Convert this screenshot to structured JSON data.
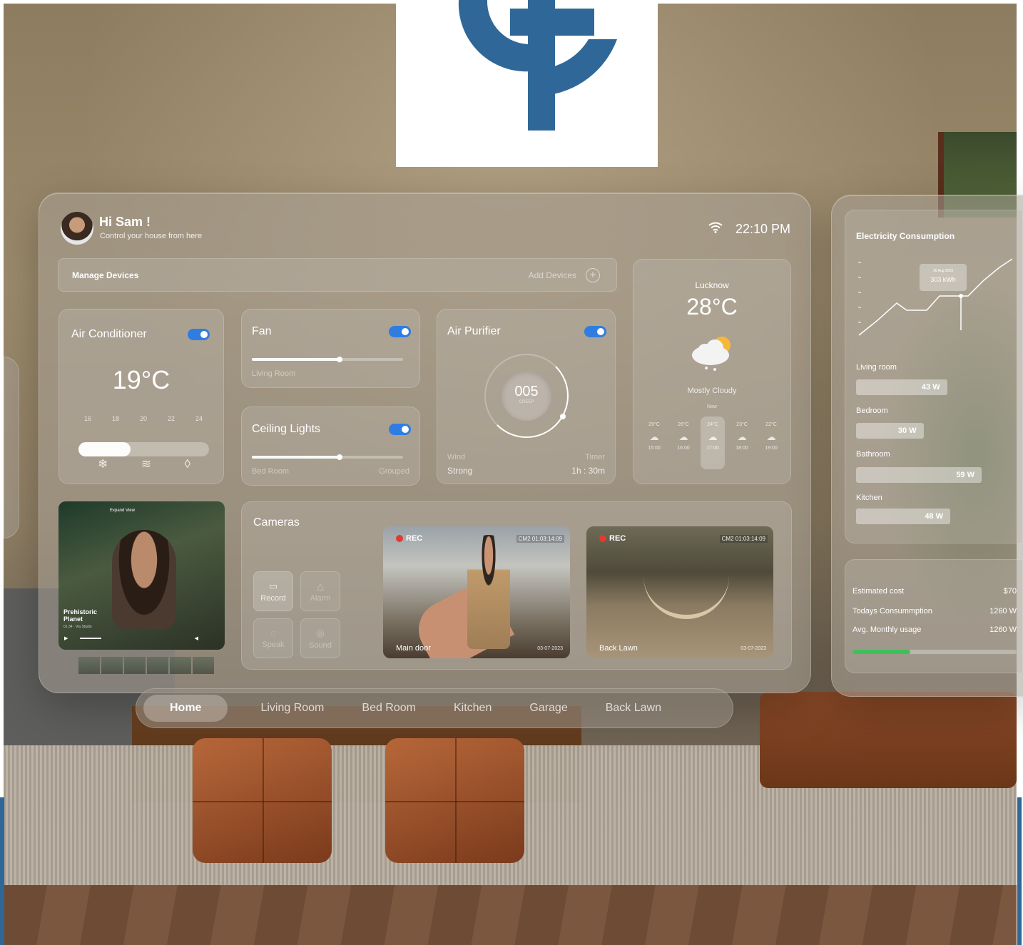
{
  "header": {
    "greeting": "Hi Sam !",
    "subtitle": "Control your house from here",
    "time": "22:10 PM"
  },
  "manage": {
    "label": "Manage Devices",
    "add_label": "Add Devices"
  },
  "ac": {
    "title": "Air Conditioner",
    "temp": "19°C",
    "scale": [
      "16",
      "18",
      "20",
      "22",
      "24"
    ],
    "level": 0.4,
    "modes": [
      "snowflake-icon",
      "wind-icon",
      "droplet-icon"
    ],
    "on": true
  },
  "fan": {
    "title": "Fan",
    "room": "Living Room",
    "level": 0.58,
    "on": true
  },
  "lights": {
    "title": "Ceiling Lights",
    "room": "Bed Room",
    "group": "Grouped",
    "level": 0.58,
    "on": true
  },
  "purifier": {
    "title": "Air Purifier",
    "value": "005",
    "sub": "CREEP",
    "wind_label": "Wind",
    "wind_value": "Strong",
    "timer_label": "Timer",
    "timer_value": "1h : 30m",
    "on": true
  },
  "weather": {
    "city": "Lucknow",
    "temp": "28°C",
    "condition": "Mostly Cloudy",
    "now_label": "Now",
    "hourly": [
      {
        "temp": "29°C",
        "time": "15:00"
      },
      {
        "temp": "26°C",
        "time": "16:00"
      },
      {
        "temp": "24°C",
        "time": "17:00"
      },
      {
        "temp": "23°C",
        "time": "18:00"
      },
      {
        "temp": "22°C",
        "time": "19:00"
      }
    ]
  },
  "media": {
    "top_label": "Expand View",
    "title": "Prehistoric Planet",
    "sub": "01:34 · Via Studio"
  },
  "cameras": {
    "title": "Cameras",
    "buttons": [
      "Record",
      "Alarm",
      "Speak",
      "Sound"
    ],
    "feeds": [
      {
        "rec": "REC",
        "id": "CM2 01:03:14:09",
        "name": "Main door",
        "date": "03-07-2023"
      },
      {
        "rec": "REC",
        "id": "CM2 01:03:14:09",
        "name": "Back Lawn",
        "date": "03-07-2023"
      }
    ]
  },
  "nav": [
    "Home",
    "Living Room",
    "Bed Room",
    "Kitchen",
    "Garage",
    "Back Lawn"
  ],
  "electricity": {
    "title": "Electricity Consumption",
    "tooltip_date": "26 Aug 2023",
    "tooltip_value": "303 kWh",
    "rooms": [
      {
        "name": "Living room",
        "value": "43 W",
        "fraction": 0.58
      },
      {
        "name": "Bedroom",
        "value": "30 W",
        "fraction": 0.43
      },
      {
        "name": "Bathroom",
        "value": "59 W",
        "fraction": 0.8
      },
      {
        "name": "Kitchen",
        "value": "48 W",
        "fraction": 0.6
      }
    ],
    "cost": [
      {
        "label": "Estimated cost",
        "value": "$70"
      },
      {
        "label": "Todays Consummption",
        "value": "1260 W"
      },
      {
        "label": "Avg. Monthly usage",
        "value": "1260 W"
      }
    ],
    "usage_level": 0.35,
    "accent_color": "#3fbf5c"
  },
  "logo_color": "#2f6898",
  "toggle_color": "#2f7de1"
}
